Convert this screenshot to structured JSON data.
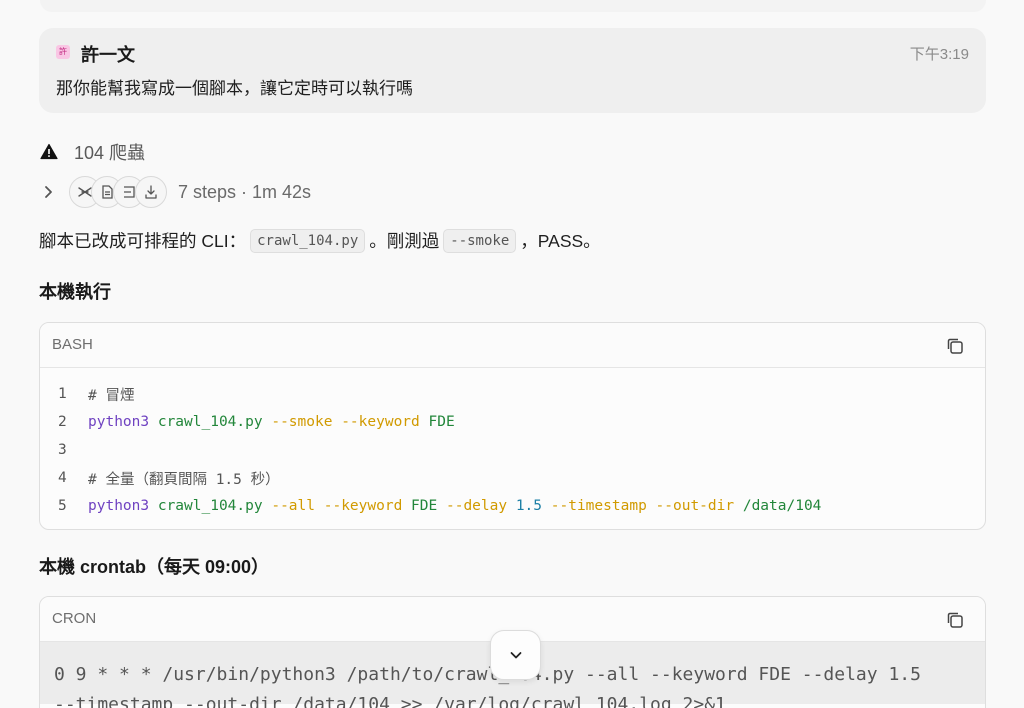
{
  "message": {
    "avatar_char": "許",
    "user": "許一文",
    "time": "下午3:19",
    "text": "那你能幫我寫成一個腳本，讓它定時可以執行嗎"
  },
  "task": {
    "icon": "warning-triangle-icon",
    "title": "104 爬蟲"
  },
  "steps": {
    "icons": [
      "crossed-tools-icon",
      "document-icon",
      "terminal-icon",
      "download-icon"
    ],
    "label": "7 steps · 1m 42s"
  },
  "reply": {
    "part1": "腳本已改成可排程的 CLI：",
    "code1": "crawl_104.py",
    "part2": "。剛測過",
    "code2": "--smoke",
    "part3": "，PASS。"
  },
  "section1": {
    "heading": "本機執行"
  },
  "bash_block": {
    "lang": "BASH",
    "lines": [
      {
        "n": "1",
        "comment": "# 冒煙"
      },
      {
        "n": "2",
        "cmd": "python3",
        "file": "crawl_104.py",
        "flags": [
          "--smoke",
          "--keyword"
        ],
        "val": "FDE"
      },
      {
        "n": "3"
      },
      {
        "n": "4",
        "comment": "# 全量（翻頁間隔 1.5 秒）"
      },
      {
        "n": "5",
        "cmd": "python3",
        "file": "crawl_104.py",
        "f1": "--all",
        "f2": "--keyword",
        "v1": "FDE",
        "f3": "--delay",
        "num": "1.5",
        "f4": "--timestamp",
        "f5": "--out-dir",
        "v2": "/data/104"
      }
    ]
  },
  "section2": {
    "heading": "本機 crontab（每天 09:00）"
  },
  "cron_block": {
    "lang": "CRON",
    "line1": "0 9 * * * /usr/bin/python3 /path/to/crawl_104.py --all --keyword FDE --delay 1.5",
    "line2": "--timestamp --out-dir /data/104 >> /var/log/crawl_104.log 2>&1"
  },
  "scroll_button": {
    "icon": "chevron-down-icon"
  }
}
